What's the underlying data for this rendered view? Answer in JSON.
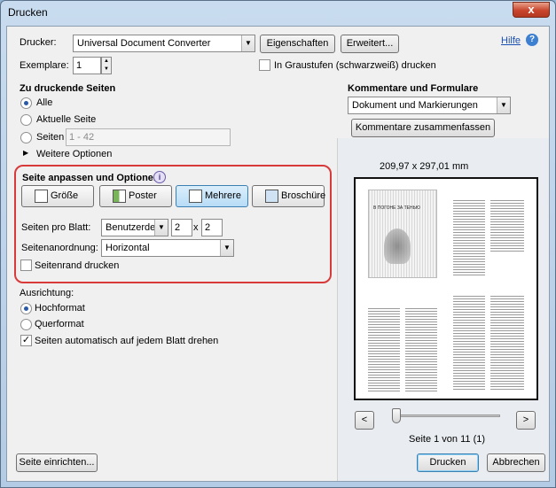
{
  "window": {
    "title": "Drucken",
    "close_label": "x"
  },
  "printer": {
    "label": "Drucker:",
    "value": "Universal Document Converter",
    "properties_button": "Eigenschaften",
    "advanced_button": "Erweitert...",
    "help_link": "Hilfe",
    "copies_label": "Exemplare:",
    "copies_value": "1",
    "grayscale_label": "In Graustufen (schwarzweiß) drucken",
    "grayscale_checked": false
  },
  "pages": {
    "heading": "Zu druckende Seiten",
    "options": [
      {
        "label": "Alle",
        "selected": true
      },
      {
        "label": "Aktuelle Seite",
        "selected": false
      },
      {
        "label": "Seiten",
        "selected": false
      }
    ],
    "range_value": "1 - 42",
    "more_options": "Weitere Optionen"
  },
  "page_handling": {
    "heading": "Seite anpassen und Optionen",
    "info_icon": "i",
    "modes": [
      {
        "label": "Größe",
        "active": false
      },
      {
        "label": "Poster",
        "active": false
      },
      {
        "label": "Mehrere",
        "active": true
      },
      {
        "label": "Broschüre",
        "active": false
      }
    ],
    "pages_per_sheet_label": "Seiten pro Blatt:",
    "pages_per_sheet_value": "Benutzerdefi",
    "cols_value": "2",
    "times": "x",
    "rows_value": "2",
    "order_label": "Seitenanordnung:",
    "order_value": "Horizontal",
    "border_label": "Seitenrand drucken",
    "border_checked": false
  },
  "orientation": {
    "heading": "Ausrichtung:",
    "options": [
      {
        "label": "Hochformat",
        "selected": true
      },
      {
        "label": "Querformat",
        "selected": false
      }
    ],
    "auto_rotate_label": "Seiten automatisch auf jedem Blatt drehen",
    "auto_rotate_checked": true
  },
  "comments": {
    "heading": "Kommentare und Formulare",
    "value": "Dokument und Markierungen",
    "summarize_button": "Kommentare zusammenfassen"
  },
  "preview": {
    "size": "209,97 x 297,01 mm",
    "prev_label": "<",
    "next_label": ">",
    "page_status": "Seite 1 von 11 (1)",
    "current_page": 1,
    "total_pages": 11,
    "book_title": "В ПОГОНЕ ЗА ТЕНЬЮ"
  },
  "footer": {
    "page_setup_button": "Seite einrichten...",
    "print_button": "Drucken",
    "cancel_button": "Abbrechen"
  }
}
